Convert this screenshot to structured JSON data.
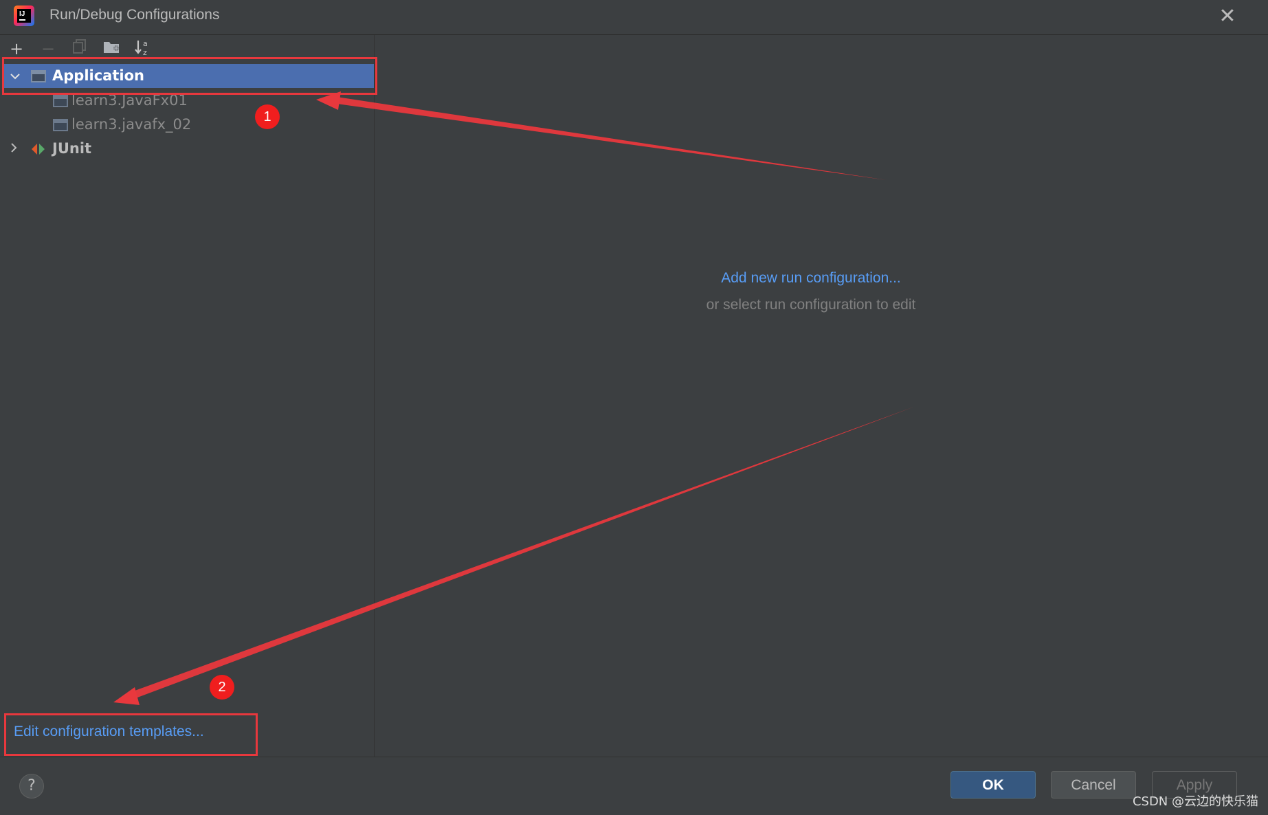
{
  "window": {
    "title": "Run/Debug Configurations",
    "close_icon": "close-icon"
  },
  "toolbar": {
    "items": [
      {
        "name": "add-icon",
        "glyph": "+"
      },
      {
        "name": "remove-icon",
        "glyph": "−"
      },
      {
        "name": "copy-icon",
        "glyph": "❐"
      },
      {
        "name": "new-folder-icon",
        "glyph": "▰"
      },
      {
        "name": "sort-alphabetically-icon",
        "glyph": "↓ᵃ"
      }
    ]
  },
  "tree": {
    "application": {
      "label": "Application",
      "expanded": true,
      "children": [
        "learn3.JavaFx01",
        "learn3.javafx_02"
      ]
    },
    "junit": {
      "label": "JUnit",
      "expanded": false
    }
  },
  "main": {
    "add_link": "Add new run configuration...",
    "hint": "or select run configuration to edit"
  },
  "footer": {
    "templates_link": "Edit configuration templates...",
    "help": "?",
    "ok": "OK",
    "cancel": "Cancel",
    "apply": "Apply"
  },
  "annotations": {
    "badge_1": "1",
    "badge_2": "2",
    "color": "#e8383d"
  },
  "watermark": "CSDN @云边的快乐猫",
  "colors": {
    "background": "#3c3f41",
    "selection": "#4b6eaf",
    "link": "#589df6",
    "ok_button": "#365880"
  }
}
